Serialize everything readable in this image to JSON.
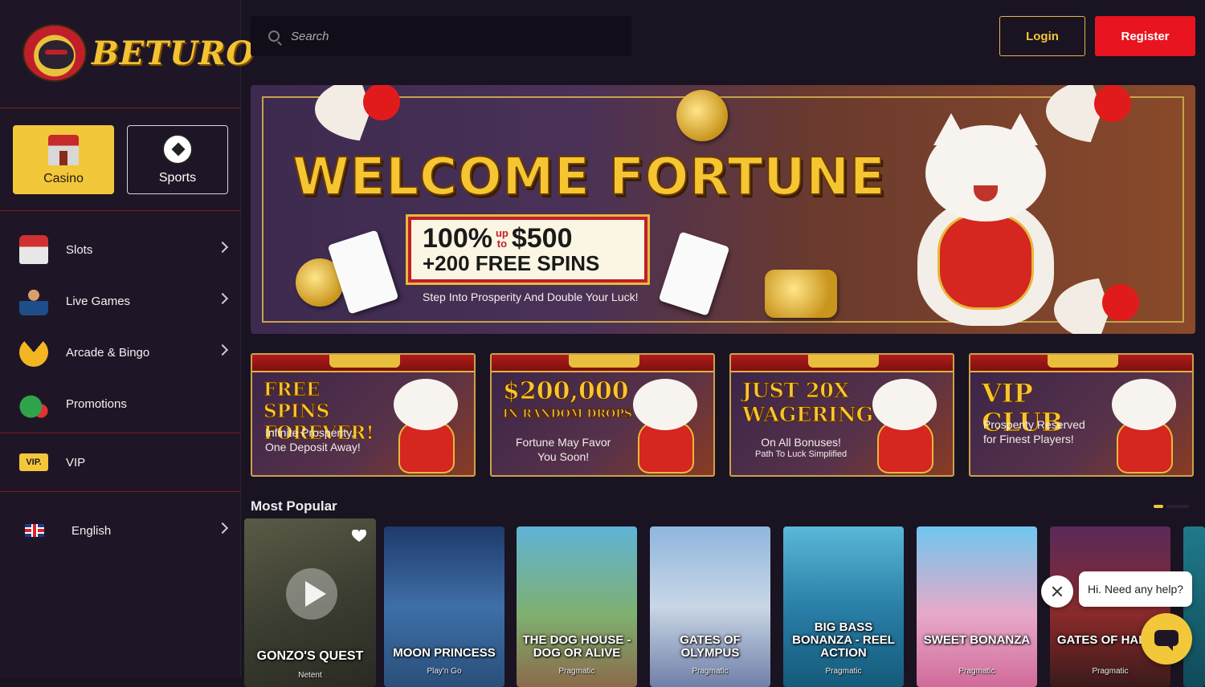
{
  "brand": {
    "name": "BETURO"
  },
  "categories": [
    {
      "label": "Casino",
      "icon": "casino-icon",
      "active": true
    },
    {
      "label": "Sports",
      "icon": "soccer-ball-icon",
      "active": false
    }
  ],
  "nav": [
    {
      "label": "Slots",
      "icon": "slot-machine-icon"
    },
    {
      "label": "Live Games",
      "icon": "live-dealer-icon"
    },
    {
      "label": "Arcade & Bingo",
      "icon": "pacman-icon"
    },
    {
      "label": "Promotions",
      "icon": "money-bag-icon"
    }
  ],
  "vip": {
    "label": "VIP",
    "badge": "VIP."
  },
  "language": {
    "label": "English",
    "icon": "uk-flag-icon"
  },
  "search": {
    "placeholder": "Search"
  },
  "auth": {
    "login": "Login",
    "register": "Register"
  },
  "hero": {
    "title": "WELCOME FORTUNE",
    "offer_amount": "100%",
    "offer_upto_1": "up",
    "offer_upto_2": "to",
    "offer_max": "$500",
    "offer_spins": "+200 FREE SPINS",
    "tagline": "Step Into Prosperity And Double Your Luck!"
  },
  "promos": [
    {
      "title": "FREE SPINS FOREVER!",
      "sub1": "Infinite Prosperity,",
      "sub2": "One Deposit Away!"
    },
    {
      "title": "$200,000",
      "title2": "IN RANDOM DROPS",
      "sub1": "Fortune May Favor",
      "sub2": "You Soon!"
    },
    {
      "title": "JUST 20x WAGERING",
      "sub1": "On All Bonuses!",
      "sub2": "Path To Luck Simplified"
    },
    {
      "title": "VIP CLUB",
      "sub1": "Prosperity Reserved",
      "sub2": "for Finest Players!"
    }
  ],
  "section": {
    "most_popular": "Most Popular"
  },
  "games": [
    {
      "title": "GONZO'S QUEST",
      "provider": "Netent"
    },
    {
      "title": "MOON PRINCESS",
      "provider": "Play'n Go"
    },
    {
      "title": "THE DOG HOUSE - DOG OR ALIVE",
      "provider": "Pragmatic"
    },
    {
      "title": "GATES OF OLYMPUS",
      "provider": "Pragmatic"
    },
    {
      "title": "BIG BASS BONANZA - REEL ACTION",
      "provider": "Pragmatic"
    },
    {
      "title": "SWEET BONANZA",
      "provider": "Pragmatic"
    },
    {
      "title": "GATES OF HADES",
      "provider": "Pragmatic"
    }
  ],
  "chat": {
    "greeting": "Hi. Need any help?"
  },
  "colors": {
    "accent": "#f3c73a",
    "register": "#e8141f",
    "sidebar": "#1e1626",
    "page": "#1a1322"
  }
}
